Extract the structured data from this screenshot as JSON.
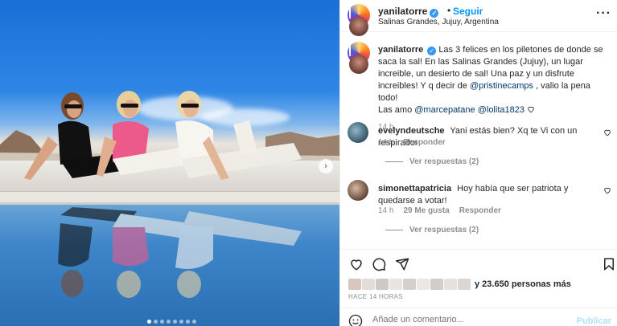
{
  "post": {
    "username": "yanilatorre",
    "follow_label": "Seguir",
    "separator": "•",
    "location": "Salinas Grandes, Jujuy, Argentina",
    "more_label": "···"
  },
  "caption": {
    "username": "yanilatorre",
    "text_1": "Las 3 felices en los piletones de donde se saca la sal! En las Salinas Grandes (Jujuy), un lugar increible, un desierto de sal! Una paz y un disfrute increibles! Y q decir de",
    "mention_1": "@pristinecamps",
    "text_2": ", valio la pena todo!",
    "text_3": "Las amo",
    "mention_2": "@marcepatane",
    "mention_3": "@lolita1823",
    "time": "14 h"
  },
  "comments": [
    {
      "username": "evelyndeutsche",
      "text": "Yani estás bien? Xq te Vi con un respirador",
      "time": "14 h",
      "likes": "",
      "reply_label": "Responder",
      "view_replies": "Ver respuestas (2)"
    },
    {
      "username": "simonettapatricia",
      "text": "Hoy había que ser patriota y quedarse a votar!",
      "time": "14 h",
      "likes": "29 Me gusta",
      "reply_label": "Responder",
      "view_replies": "Ver respuestas (2)"
    }
  ],
  "likes_text": "y 23.650 personas más",
  "posted_ago": "HACE 14 HORAS",
  "add_comment": {
    "placeholder": "Añade un comentario...",
    "post_label": "Publicar"
  },
  "colors": {
    "accent": "#0095f6",
    "verified": "#3897f0",
    "muted": "#8e8e8e"
  },
  "icons": [
    "verified-badge-icon",
    "more-options-icon",
    "heart-icon",
    "comment-icon",
    "share-icon",
    "bookmark-icon",
    "emoji-icon",
    "chevron-right-icon"
  ]
}
